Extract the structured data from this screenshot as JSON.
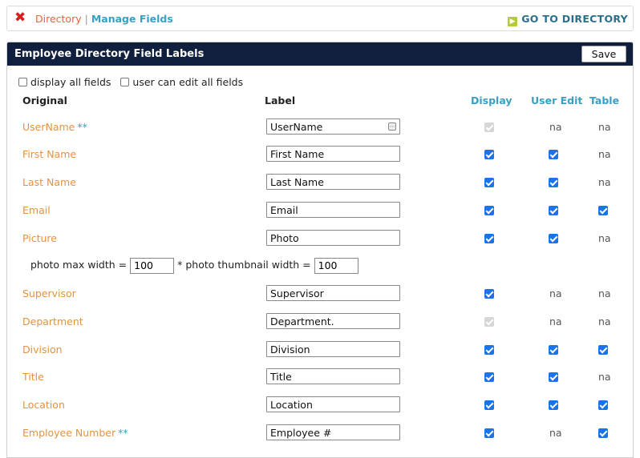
{
  "breadcrumb": {
    "home": "Directory",
    "separator": "|",
    "current": "Manage Fields",
    "go_to": "GO TO DIRECTORY"
  },
  "panel": {
    "title": "Employee Directory Field Labels",
    "save_label": "Save",
    "display_all_label": "display all fields",
    "edit_all_label": "user can edit all fields"
  },
  "columns": {
    "original": "Original",
    "label": "Label",
    "display": "Display",
    "user_edit": "User Edit",
    "table": "Table"
  },
  "photo": {
    "max_width_label": "photo max width =",
    "max_width_value": "100",
    "thumb_label": "* photo thumbnail width =",
    "thumb_value": "100"
  },
  "na_text": "na",
  "fields": [
    {
      "original": "UserName",
      "stars": "**",
      "label": "UserName"
    },
    {
      "original": "First Name",
      "stars": "",
      "label": "First Name"
    },
    {
      "original": "Last Name",
      "stars": "",
      "label": "Last Name"
    },
    {
      "original": "Email",
      "stars": "",
      "label": "Email"
    },
    {
      "original": "Picture",
      "stars": "",
      "label": "Photo"
    },
    {
      "original": "Supervisor",
      "stars": "",
      "label": "Supervisor"
    },
    {
      "original": "Department",
      "stars": "",
      "label": "Department."
    },
    {
      "original": "Division",
      "stars": "",
      "label": "Division"
    },
    {
      "original": "Title",
      "stars": "",
      "label": "Title"
    },
    {
      "original": "Location",
      "stars": "",
      "label": "Location"
    },
    {
      "original": "Employee Number",
      "stars": "**",
      "label": "Employee #"
    }
  ]
}
